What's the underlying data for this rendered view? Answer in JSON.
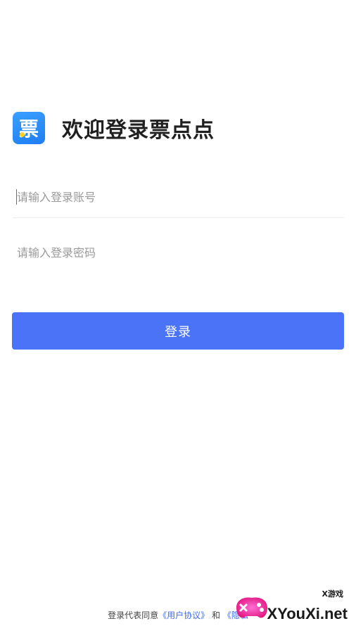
{
  "header": {
    "logo_glyph": "票",
    "title": "欢迎登录票点点"
  },
  "form": {
    "account_placeholder": "请输入登录账号",
    "password_placeholder": "请输入登录密码",
    "login_label": "登录"
  },
  "agreement": {
    "prefix": "登录代表同意",
    "user_agreement": "《用户协议》",
    "conjunction": "和",
    "privacy_policy": "《隐私"
  },
  "watermark": {
    "text": "XYouXi.net",
    "sub": "X游戏"
  },
  "colors": {
    "primary": "#4a73f7",
    "logo_gradient_start": "#3aa0ff",
    "logo_gradient_end": "#1f7df5",
    "logo_dot": "#ffd21f",
    "link": "#3b6cf6"
  },
  "icons": {
    "logo": "ticket-logo-icon",
    "watermark_logo": "gamepad-icon"
  }
}
